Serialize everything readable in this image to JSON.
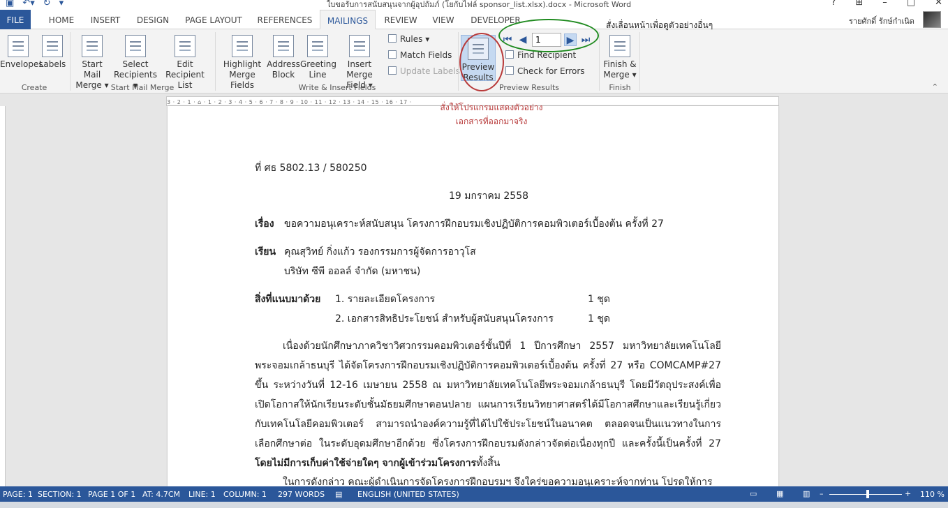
{
  "window": {
    "title": "ใบขอรับการสนับสนุนจากผู้อุปถัมภ์ (โยกับไฟล์ sponsor_list.xlsx).docx - Microsoft Word",
    "user_name": "รายศักดิ์ รักษ์กำเนิด"
  },
  "tabs": [
    "FILE",
    "HOME",
    "INSERT",
    "DESIGN",
    "PAGE LAYOUT",
    "REFERENCES",
    "MAILINGS",
    "REVIEW",
    "VIEW",
    "DEVELOPER"
  ],
  "active_tab": "MAILINGS",
  "ribbon": {
    "create": {
      "label": "Create",
      "envelopes": "Envelopes",
      "labels": "Labels"
    },
    "start_mail_merge": {
      "label": "Start Mail Merge",
      "start": [
        "Start Mail",
        "Merge ▾"
      ],
      "select": [
        "Select",
        "Recipients ▾"
      ],
      "edit": [
        "Edit",
        "Recipient List"
      ]
    },
    "write_insert": {
      "label": "Write & Insert Fields",
      "highlight": [
        "Highlight",
        "Merge Fields"
      ],
      "address": [
        "Address",
        "Block"
      ],
      "greeting": [
        "Greeting",
        "Line"
      ],
      "insert_merge": [
        "Insert Merge",
        "Field ▾"
      ],
      "rules": "Rules ▾",
      "match_fields": "Match Fields",
      "update_labels": "Update Labels"
    },
    "preview": {
      "label": "Preview Results",
      "button": [
        "Preview",
        "Results"
      ],
      "record": "1",
      "find_recipient": "Find Recipient",
      "check_errors": "Check for Errors"
    },
    "finish": {
      "label": "Finish",
      "button": [
        "Finish &",
        "Merge ▾"
      ]
    }
  },
  "annotations": {
    "nav_note": "สั่งเลื่อนหน้าเพื่อดูตัวอย่างอื่นๆ",
    "preview_note_1": "สั่งให้โปรแกรมแสดงตัวอย่าง",
    "preview_note_2": "เอกสารที่ออกมาจริง"
  },
  "ruler": {
    "ticks": "3 · 2 · 1 · ⌂ · 1 · 2 · 3 · 4 · 5 · 6 · 7 · 8 · 9 · 10 · 11 · 12 · 13 · 14 · 15 · 16 · 17 ·"
  },
  "document": {
    "ref_no": "ที่ ศธ 5802.13 / 580250",
    "date": "19 มกราคม 2558",
    "subject_label": "เรื่อง",
    "subject": "ขอความอนุเคราะห์สนับสนุน โครงการฝึกอบรมเชิงปฏิบัติการคอมพิวเตอร์เบื้องต้น ครั้งที่ 27",
    "to_label": "เรียน",
    "to_line1": "คุณสุวิทย์ กิ่งแก้ว รองกรรมการผู้จัดการอาวุโส",
    "to_line2": "บริษัท ซีพี ออลล์ จำกัด (มหาชน)",
    "attach_label": "สิ่งที่แนบมาด้วย",
    "attach1": "1. รายละเอียดโครงการ",
    "attach1_qty": "1 ชุด",
    "attach2": "2. เอกสารสิทธิประโยชน์ สำหรับผู้สนับสนุนโครงการ",
    "attach2_qty": "1 ชุด",
    "body": "เนื่องด้วยนักศึกษาภาควิชาวิศวกรรมคอมพิวเตอร์ชั้นปีที่ 1 ปีการศึกษา 2557 มหาวิทยาลัยเทคโนโลยีพระจอมเกล้าธนบุรี ได้จัดโครงการฝึกอบรมเชิงปฏิบัติการคอมพิวเตอร์เบื้องต้น ครั้งที่ 27 หรือ COMCAMP#27 ขึ้น ระหว่างวันที่ 12-16 เมษายน 2558 ณ มหาวิทยาลัยเทคโนโลยีพระจอมเกล้าธนบุรี โดยมีวัตถุประสงค์เพื่อเปิดโอกาสให้นักเรียนระดับชั้นมัธยมศึกษาตอนปลาย แผนการเรียนวิทยาศาสตร์ได้มีโอกาสศึกษาและเรียนรู้เกี่ยวกับเทคโนโลยีคอมพิวเตอร์ สามารถนำองค์ความรู้ที่ได้ไปใช้ประโยชน์ในอนาคต ตลอดจนเป็นแนวทางในการเลือกศึกษาต่อ ในระดับอุดมศึกษาอีกด้วย ซึ่งโครงการฝึกอบรมดังกล่าวจัดต่อเนื่องทุกปี และครั้งนี้เป็นครั้งที่ 27",
    "body_bold": "โดยไม่มีการเก็บค่าใช้จ่ายใดๆ จากผู้เข้าร่วมโครงการ",
    "body_end": "ทั้งสิ้น",
    "body2": "ในการดังกล่าว คณะผู้ดำเนินการจัดโครงการฝึกอบรมฯ จึงใคร่ขอความอนุเคราะห์จากท่าน โปรดให้การ"
  },
  "status": {
    "page": "PAGE: 1",
    "section": "SECTION: 1",
    "page_of": "PAGE 1 OF 1",
    "at": "AT: 4.7CM",
    "line": "LINE: 1",
    "column": "COLUMN: 1",
    "words": "297 WORDS",
    "language": "ENGLISH (UNITED STATES)",
    "zoom": "110 %"
  }
}
